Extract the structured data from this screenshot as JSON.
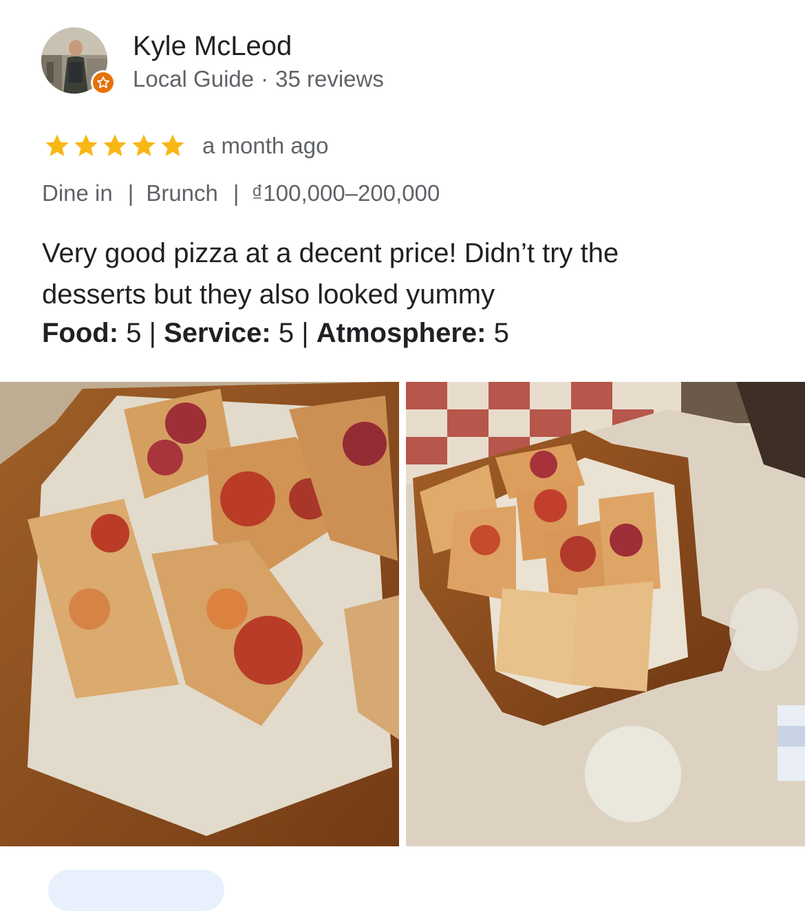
{
  "reviewer": {
    "name": "Kyle McLeod",
    "badge": "Local Guide",
    "separator": "·",
    "review_count": "35 reviews"
  },
  "review": {
    "rating": 5,
    "max_rating": 5,
    "time": "a month ago",
    "tags": [
      "Dine in",
      "Brunch",
      "₫100,000–200,000"
    ],
    "tag_separator": "|",
    "text_line1": "Very good pizza at a decent price! Didn’t try the",
    "text_line2": "desserts but they also looked yummy",
    "sub_ratings": [
      {
        "label": "Food:",
        "value": "5"
      },
      {
        "label": "Service:",
        "value": "5"
      },
      {
        "label": "Atmosphere:",
        "value": "5"
      }
    ],
    "sub_rating_separator": "|"
  },
  "photos": [
    {
      "name": "pizza-closeup-photo"
    },
    {
      "name": "pizza-board-table-photo"
    }
  ],
  "colors": {
    "star": "#f9b715",
    "badge": "#e8710a",
    "secondary_text": "#5f6368",
    "primary_text": "#202124"
  }
}
